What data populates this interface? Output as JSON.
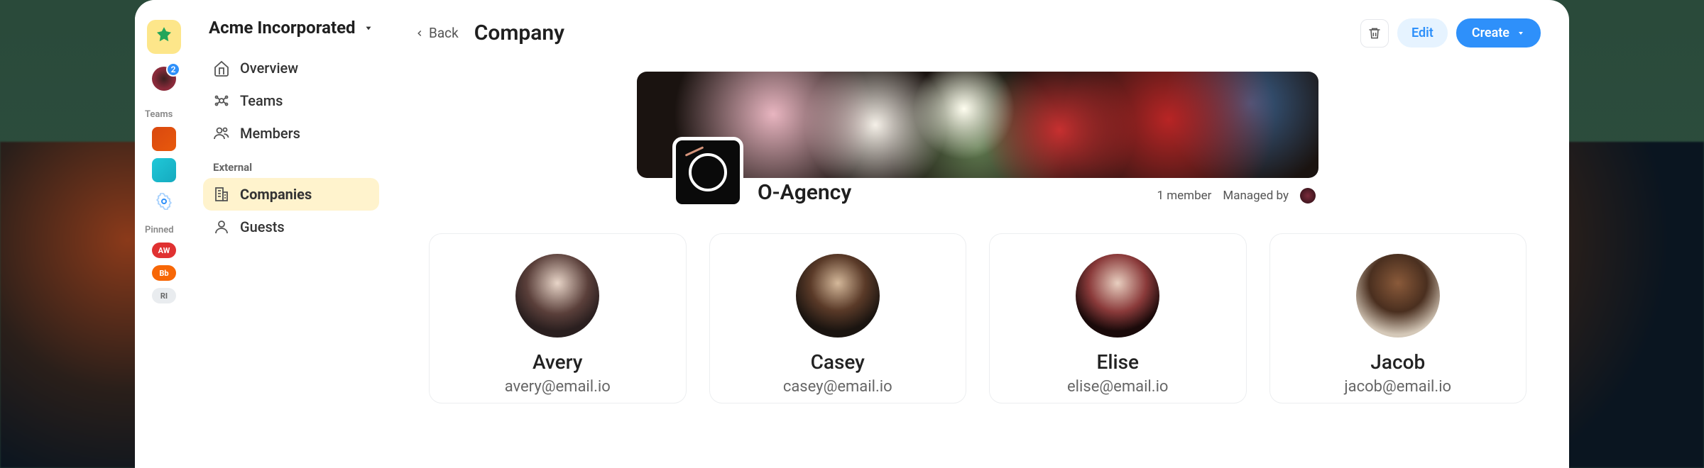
{
  "rail": {
    "badge_count": "2",
    "sections": {
      "teams": "Teams",
      "pinned": "Pinned"
    },
    "pinned": [
      "AW",
      "Bb",
      "RI"
    ]
  },
  "workspace": {
    "name": "Acme Incorporated"
  },
  "sidebar": {
    "items": [
      {
        "icon": "home",
        "label": "Overview"
      },
      {
        "icon": "teams",
        "label": "Teams"
      },
      {
        "icon": "members",
        "label": "Members"
      }
    ],
    "external_label": "External",
    "external": [
      {
        "icon": "building",
        "label": "Companies",
        "active": true
      },
      {
        "icon": "guest",
        "label": "Guests"
      }
    ]
  },
  "topbar": {
    "back": "Back",
    "title": "Company",
    "edit": "Edit",
    "create": "Create"
  },
  "company": {
    "name": "O-Agency",
    "member_count": "1 member",
    "managed_by": "Managed by"
  },
  "members": [
    {
      "name": "Avery",
      "email": "avery@email.io"
    },
    {
      "name": "Casey",
      "email": "casey@email.io"
    },
    {
      "name": "Elise",
      "email": "elise@email.io"
    },
    {
      "name": "Jacob",
      "email": "jacob@email.io"
    }
  ]
}
